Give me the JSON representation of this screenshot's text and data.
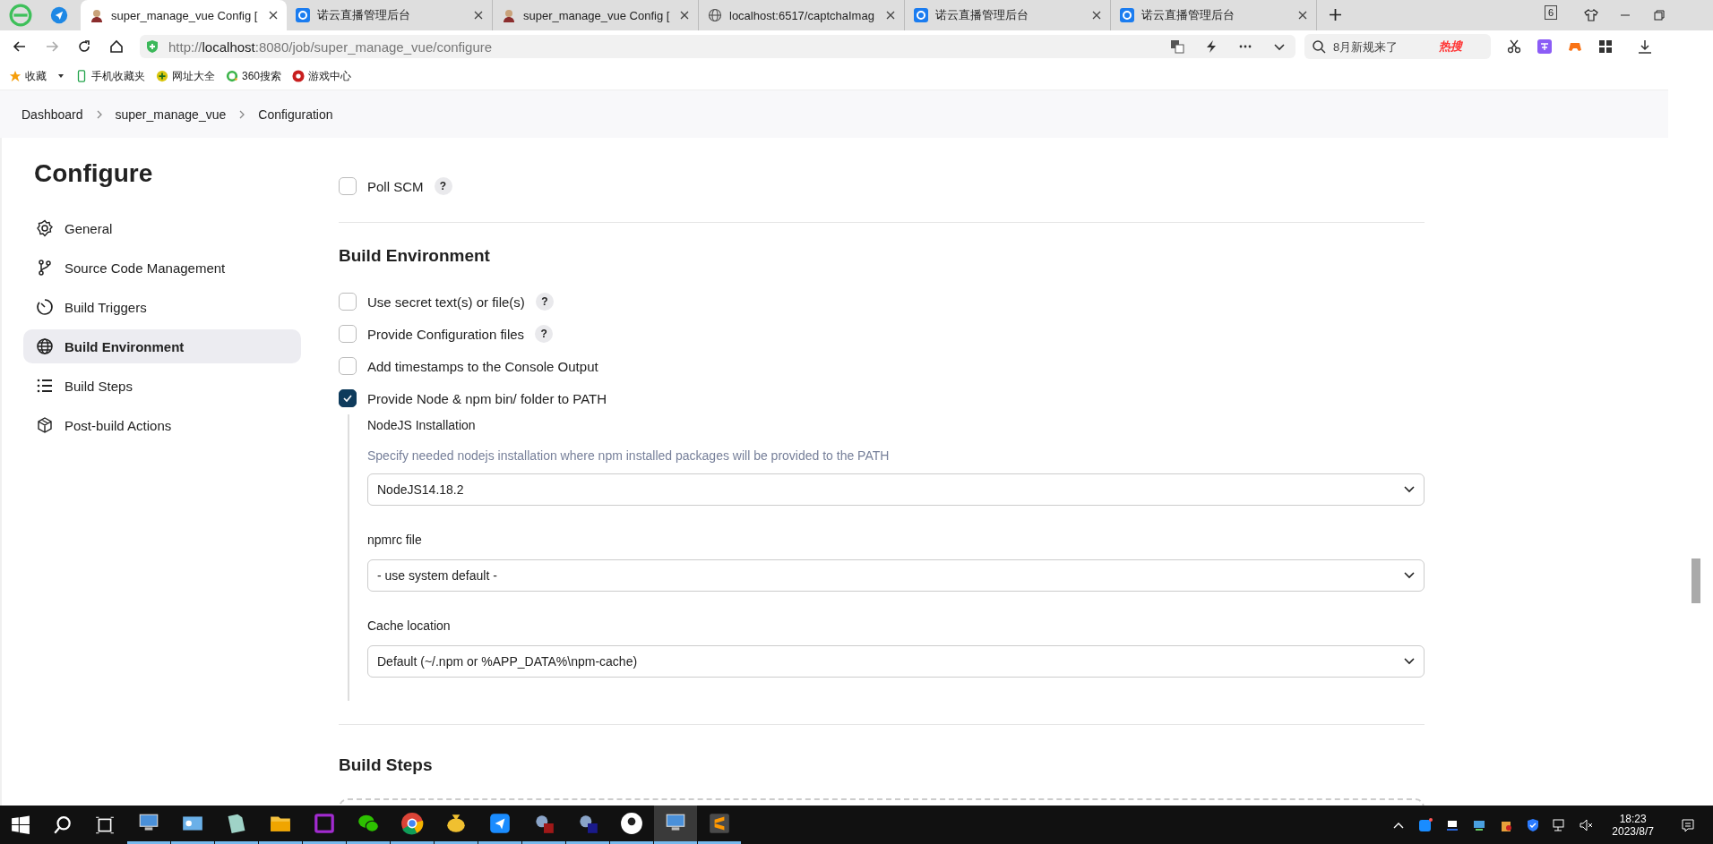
{
  "tabs": [
    {
      "title": "super_manage_vue Config [",
      "kind": "person",
      "selected": true
    },
    {
      "title": "诺云直播管理后台",
      "kind": "app",
      "selected": false
    },
    {
      "title": "super_manage_vue Config [",
      "kind": "person",
      "selected": false
    },
    {
      "title": "localhost:6517/captchaImag",
      "kind": "globe",
      "selected": false
    },
    {
      "title": "诺云直播管理后台",
      "kind": "app",
      "selected": false
    },
    {
      "title": "诺云直播管理后台",
      "kind": "app",
      "selected": false
    }
  ],
  "tab_count": "6",
  "address": {
    "prefix": "http://",
    "host": "localhost",
    "rest": ":8080/job/super_manage_vue/configure"
  },
  "search": {
    "placeholder": "8月新规来了",
    "hot": "热搜"
  },
  "bookmarks": [
    {
      "label": "收藏",
      "kind": "star"
    },
    {
      "label": "手机收藏夹",
      "kind": "phone"
    },
    {
      "label": "网址大全",
      "kind": "plus"
    },
    {
      "label": "360搜索",
      "kind": "ring"
    },
    {
      "label": "游戏中心",
      "kind": "game"
    }
  ],
  "breadcrumbs": [
    "Dashboard",
    "super_manage_vue",
    "Configuration"
  ],
  "sidebar": {
    "title": "Configure",
    "items": [
      {
        "label": "General",
        "kind": "gear",
        "selected": false
      },
      {
        "label": "Source Code Management",
        "kind": "branch",
        "selected": false
      },
      {
        "label": "Build Triggers",
        "kind": "clock",
        "selected": false
      },
      {
        "label": "Build Environment",
        "kind": "globe",
        "selected": true
      },
      {
        "label": "Build Steps",
        "kind": "list",
        "selected": false
      },
      {
        "label": "Post-build Actions",
        "kind": "box",
        "selected": false
      }
    ]
  },
  "poll_scm": {
    "label": "Poll SCM",
    "checked": false,
    "help": "?"
  },
  "build_environment": {
    "title": "Build Environment",
    "options": [
      {
        "label": "Use secret text(s) or file(s)",
        "checked": false,
        "help": "?"
      },
      {
        "label": "Provide Configuration files",
        "checked": false,
        "help": "?"
      },
      {
        "label": "Add timestamps to the Console Output",
        "checked": false
      },
      {
        "label": "Provide Node & npm bin/ folder to PATH",
        "checked": true
      }
    ],
    "nodejs": {
      "label": "NodeJS Installation",
      "description": "Specify needed nodejs installation where npm installed packages will be provided to the PATH",
      "value": "NodeJS14.18.2"
    },
    "fields": [
      {
        "label": "npmrc file",
        "value": "- use system default -"
      },
      {
        "label": "Cache location",
        "value": "Default (~/.npm or %APP_DATA%\\npm-cache)"
      }
    ]
  },
  "build_steps": {
    "title": "Build Steps"
  },
  "clock": {
    "time": "18:23",
    "date": "2023/8/7"
  }
}
